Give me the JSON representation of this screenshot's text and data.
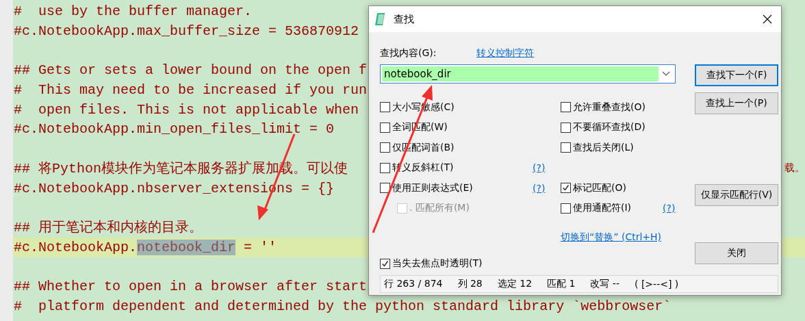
{
  "editor": {
    "lines": [
      {
        "kind": "code",
        "text": "#  use by the buffer manager.",
        "current": false
      },
      {
        "kind": "code",
        "text": "#c.NotebookApp.max_buffer_size = 536870912",
        "current": false
      },
      {
        "kind": "blank"
      },
      {
        "kind": "code",
        "text": "## Gets or sets a lower bound on the open f",
        "current": false
      },
      {
        "kind": "code",
        "text": "#  This may need to be increased if you run",
        "current": false
      },
      {
        "kind": "code",
        "text": "#  open files. This is not applicable when",
        "current": false
      },
      {
        "kind": "code",
        "text": "#c.NotebookApp.min_open_files_limit = 0",
        "current": false
      },
      {
        "kind": "blank"
      },
      {
        "kind": "code",
        "text": "## 将Python模块作为笔记本服务器扩展加载。可以使",
        "tail": "载。",
        "current": false
      },
      {
        "kind": "code",
        "text": "#c.NotebookApp.nbserver_extensions = {}",
        "current": false
      },
      {
        "kind": "blank"
      },
      {
        "kind": "code",
        "text": "## 用于笔记本和内核的目录。",
        "current": false
      },
      {
        "kind": "code",
        "text": "#c.NotebookApp.",
        "selection": "notebook_dir",
        "after": " = ''",
        "current": true
      },
      {
        "kind": "blank"
      },
      {
        "kind": "code",
        "text": "## Whether to open in a browser after start",
        "current": false
      },
      {
        "kind": "code",
        "text": "#  platform dependent and determined by the python standard library `webbrowser`",
        "current": false
      }
    ]
  },
  "dialog": {
    "title": "查找",
    "find_label": "查找内容(G):",
    "escape_link": "转义控制字符",
    "search": {
      "value": "notebook_dir"
    },
    "buttons": [
      {
        "label": "查找下一个(F)",
        "default": true
      },
      {
        "label": "查找上一个(P)",
        "default": false
      }
    ],
    "option_rows": [
      {
        "left": {
          "label": "大小写敏感(C)",
          "checked": false,
          "disabled": false,
          "indent": false
        },
        "right": {
          "label": "允许重叠查找(O)",
          "checked": false
        }
      },
      {
        "left": {
          "label": "全词匹配(W)",
          "checked": false,
          "disabled": false,
          "indent": false
        },
        "right": {
          "label": "不要循环查找(D)",
          "checked": false
        }
      },
      {
        "left": {
          "label": "仅匹配词首(B)",
          "checked": false,
          "disabled": false,
          "indent": false
        },
        "right": {
          "label": "查找后关闭(L)",
          "checked": false
        }
      },
      {
        "left": {
          "label": "转义反斜杠(T)",
          "checked": false,
          "disabled": false,
          "indent": false,
          "help": "(?)"
        }
      },
      {
        "left": {
          "label": "使用正则表达式(E)",
          "checked": false,
          "disabled": false,
          "indent": false,
          "help": "(?)"
        },
        "right": {
          "label": "标记匹配(O)",
          "checked": true
        }
      },
      {
        "left": {
          "label": ". 匹配所有(M)",
          "checked": false,
          "disabled": true,
          "indent": true
        },
        "right": {
          "label": "使用通配符(I)",
          "checked": false,
          "help": "(?)"
        }
      }
    ],
    "filter_button": "仅显示匹配行(V)",
    "replace_link": "切换到“替换” (Ctrl+H)",
    "close_button": "关闭",
    "transparent": {
      "label": "当失去焦点时透明(T)",
      "checked": true
    },
    "status": [
      "行 263 / 874",
      "列 28",
      "选定 12",
      "匹配 1",
      "改写 --",
      "( [>--<] )"
    ]
  }
}
